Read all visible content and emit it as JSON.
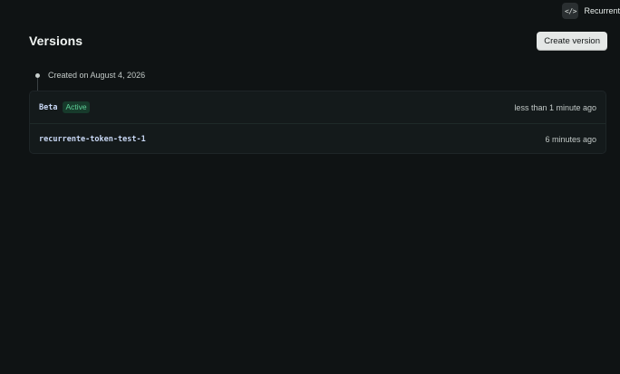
{
  "topbar": {
    "code_icon_glyph": "</>",
    "project_name": "Recurrent"
  },
  "header": {
    "title": "Versions",
    "create_button_label": "Create version"
  },
  "timeline": {
    "created_label": "Created on August 4, 2026"
  },
  "versions": [
    {
      "name": "Beta",
      "badge": "Active",
      "time": "less than 1 minute ago"
    },
    {
      "name": "recurrente-token-test-1",
      "time": "6 minutes ago"
    }
  ],
  "colors": {
    "background": "#0f1314",
    "card_background": "#141a1b",
    "active_badge_text": "#5fd39a",
    "active_badge_background": "#173a2b",
    "version_name": "#c9d8f5",
    "button_background": "#e4e7e6"
  }
}
